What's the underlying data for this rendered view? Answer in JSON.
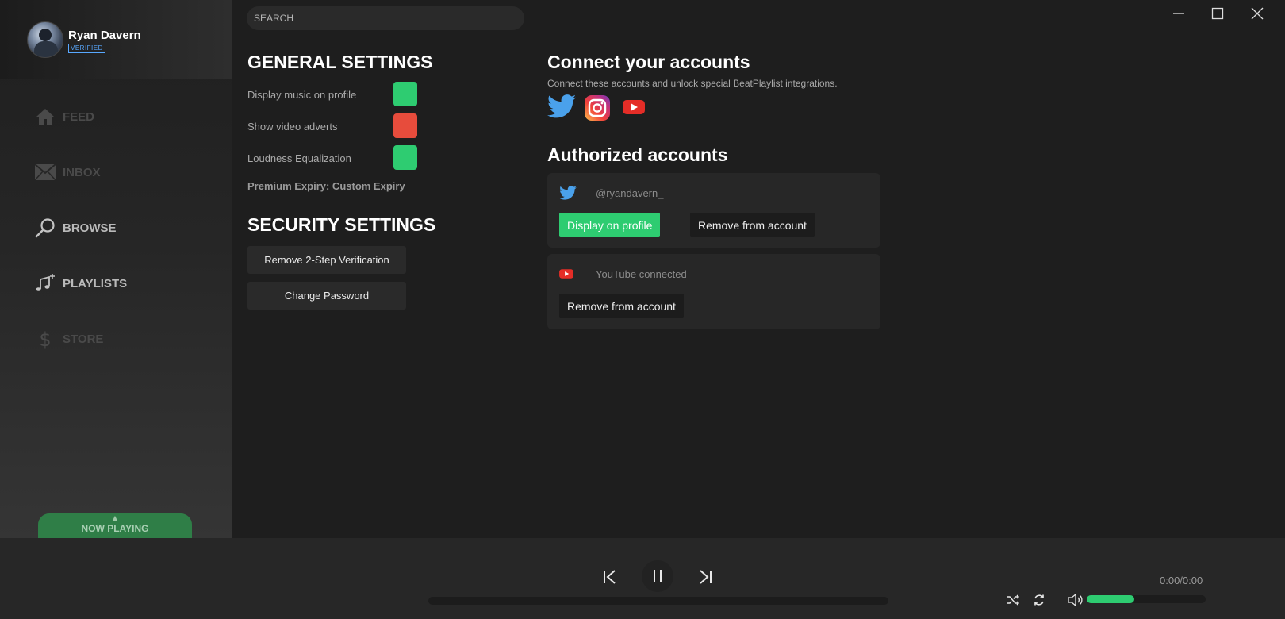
{
  "window": {
    "minimize_icon": "minimize-icon",
    "maximize_icon": "maximize-icon",
    "close_icon": "close-icon"
  },
  "user": {
    "name": "Ryan Davern",
    "badge": "VERIFIED"
  },
  "search": {
    "placeholder": "SEARCH"
  },
  "sidebar": {
    "items": [
      {
        "label": "FEED",
        "icon": "home-icon",
        "state": "dim"
      },
      {
        "label": "INBOX",
        "icon": "mail-icon",
        "state": "dim"
      },
      {
        "label": "BROWSE",
        "icon": "search-icon",
        "state": "active"
      },
      {
        "label": "PLAYLISTS",
        "icon": "music-note-icon",
        "state": "active"
      },
      {
        "label": "STORE",
        "icon": "dollar-icon",
        "state": "dim"
      }
    ],
    "now_playing": "NOW PLAYING"
  },
  "general": {
    "title": "GENERAL SETTINGS",
    "settings": [
      {
        "label": "Display music on profile",
        "enabled": true,
        "color": "#2ecc71"
      },
      {
        "label": "Show video adverts",
        "enabled": false,
        "color": "#e74c3c"
      },
      {
        "label": "Loudness Equalization",
        "enabled": true,
        "color": "#2ecc71"
      }
    ],
    "expiry": "Premium Expiry: Custom Expiry"
  },
  "security": {
    "title": "SECURITY SETTINGS",
    "buttons": [
      "Remove 2-Step Verification",
      "Change Password"
    ]
  },
  "connect": {
    "title": "Connect your accounts",
    "subtitle": "Connect these accounts and unlock special BeatPlaylist integrations.",
    "services": [
      "twitter-icon",
      "instagram-icon",
      "youtube-icon"
    ]
  },
  "authorized": {
    "title": "Authorized accounts",
    "accounts": [
      {
        "service": "twitter",
        "handle": "@ryandavern_",
        "display_label": "Display on profile",
        "remove_label": "Remove from account"
      },
      {
        "service": "youtube",
        "handle": "YouTube connected",
        "remove_label": "Remove from account"
      }
    ]
  },
  "player": {
    "time": "0:00/0:00",
    "progress": 0,
    "volume": 0.4,
    "accent": "#2ecc71"
  }
}
